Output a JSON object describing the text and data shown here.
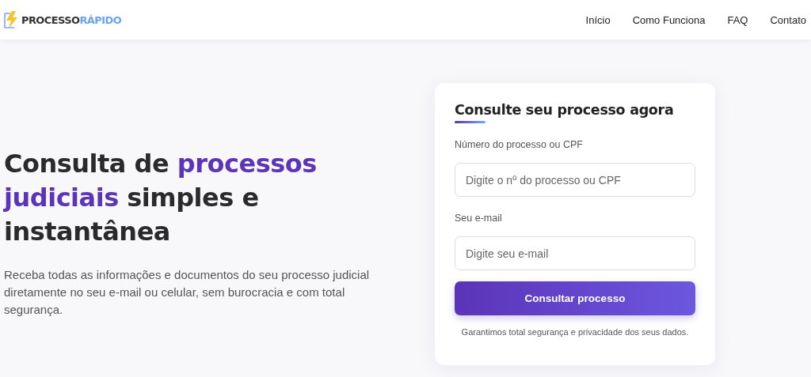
{
  "header": {
    "logo": {
      "part_1": "PROCESSO",
      "part_2": "RÁPIDO"
    },
    "nav": [
      {
        "label": "Início"
      },
      {
        "label": "Como Funciona"
      },
      {
        "label": "FAQ"
      },
      {
        "label": "Contato"
      }
    ]
  },
  "hero": {
    "headline": [
      {
        "text": "Consulta de ",
        "highlight": false
      },
      {
        "text": "processos judiciais",
        "highlight": true
      },
      {
        "text": " simples e instantânea",
        "highlight": false
      }
    ],
    "description": "Receba todas as informações e documentos do seu processo judicial diretamente no seu e-mail ou celular, sem burocracia e com total segurança."
  },
  "form": {
    "title": "Consulte seu processo agora",
    "fields": [
      {
        "label": "Número do processo ou CPF",
        "placeholder": "Digite o nº do processo ou CPF"
      },
      {
        "label": "Seu e-mail",
        "placeholder": "Digite seu e-mail"
      }
    ],
    "button": "Consultar processo",
    "note": "Garantimos total segurança e privacidade dos seus dados."
  }
}
